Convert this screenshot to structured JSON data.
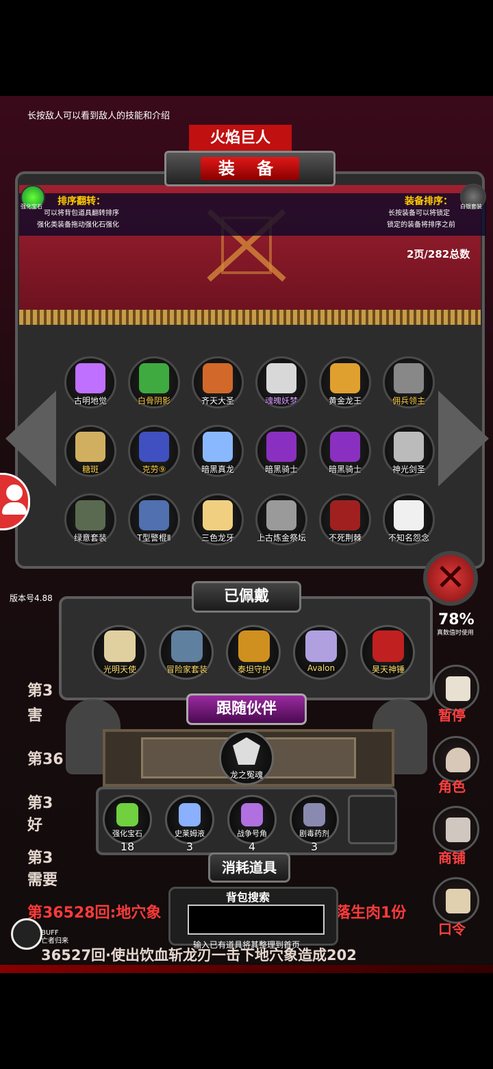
{
  "tip": "长按敌人可以看到敌人的技能和介绍",
  "boss_name": "火焰巨人",
  "panel_title": "装 备",
  "sort_reverse": {
    "title": "排序翻转：",
    "line1": "可以将背包道具翻转排序",
    "line2": "强化类装备拖动强化石强化"
  },
  "sort_equip": {
    "title": "装备排序：",
    "line1": "长按装备可以将锁定",
    "line2": "锁定的装备将排序之前"
  },
  "corner_left_label": "强化宝石",
  "corner_right_label": "白银套装",
  "page_count": "2页/282总数",
  "equipment_grid": [
    {
      "label": "古明地觉",
      "color": "#c070ff",
      "style": ""
    },
    {
      "label": "白骨阴影",
      "color": "#3faa3f",
      "style": "gold"
    },
    {
      "label": "齐天大圣",
      "color": "#d2692a",
      "style": ""
    },
    {
      "label": "魂魄妖梦",
      "color": "#d8d8d8",
      "style": "purple"
    },
    {
      "label": "黄金龙王",
      "color": "#e0a030",
      "style": ""
    },
    {
      "label": "佣兵领主",
      "color": "#888888",
      "style": "gold"
    },
    {
      "label": "糖斑",
      "color": "#d0b060",
      "style": "gold"
    },
    {
      "label": "克劳⑨",
      "color": "#4050c0",
      "style": "gold"
    },
    {
      "label": "暗黑真龙",
      "color": "#8ab8ff",
      "style": ""
    },
    {
      "label": "暗黑骑士",
      "color": "#8a30c0",
      "style": ""
    },
    {
      "label": "暗黑骑士",
      "color": "#8a30c0",
      "style": ""
    },
    {
      "label": "神光剑圣",
      "color": "#bbbbbb",
      "style": ""
    },
    {
      "label": "绿意套装",
      "color": "#5a6a50",
      "style": ""
    },
    {
      "label": "T型警棍Ⅱ",
      "color": "#5070b0",
      "style": ""
    },
    {
      "label": "三色龙牙",
      "color": "#f0d080",
      "style": ""
    },
    {
      "label": "上古炼金祭坛",
      "color": "#9a9a9a",
      "style": ""
    },
    {
      "label": "不死荆棘",
      "color": "#a02020",
      "style": ""
    },
    {
      "label": "不知名怨念",
      "color": "#f0f0f0",
      "style": ""
    }
  ],
  "version": "版本号4.88",
  "equipped_title": "已佩戴",
  "equipped": [
    {
      "label": "光明天使",
      "color": "#e0d0a0"
    },
    {
      "label": "冒险家套装",
      "color": "#6080a0"
    },
    {
      "label": "泰坦守护",
      "color": "#d09020"
    },
    {
      "label": "Avalon",
      "color": "#b0a0e0"
    },
    {
      "label": "昊天神锤",
      "color": "#c02020"
    }
  ],
  "companion_title": "跟随伙伴",
  "companion": {
    "label": "龙之冤魂"
  },
  "consumables_title": "消耗道具",
  "consumables": [
    {
      "label": "强化宝石",
      "qty": "18",
      "color": "#70d040"
    },
    {
      "label": "史莱姆液",
      "qty": "3",
      "color": "#8ab0ff"
    },
    {
      "label": "战争号角",
      "qty": "4",
      "color": "#b070e0"
    },
    {
      "label": "剧毒药剂",
      "qty": "3",
      "color": "#8a8ab0"
    }
  ],
  "search": {
    "label": "背包搜索",
    "value": "",
    "hint": "输入已有道具将其整理到首页"
  },
  "log_lines": [
    "第3",
    "害",
    "第36",
    "第3",
    "好",
    "第3",
    "需要",
    "第36528回:地穴象",
    "落生肉1份",
    "36527回·使出饮血斩龙刃一击下地穴象造成202"
  ],
  "stats_value": "78%",
  "stats_sub": "真数值时使用",
  "right_menu": [
    "暂停",
    "角色",
    "商铺",
    "口令"
  ],
  "buff_label": "BUFF",
  "buff_sub": "亡者归来"
}
